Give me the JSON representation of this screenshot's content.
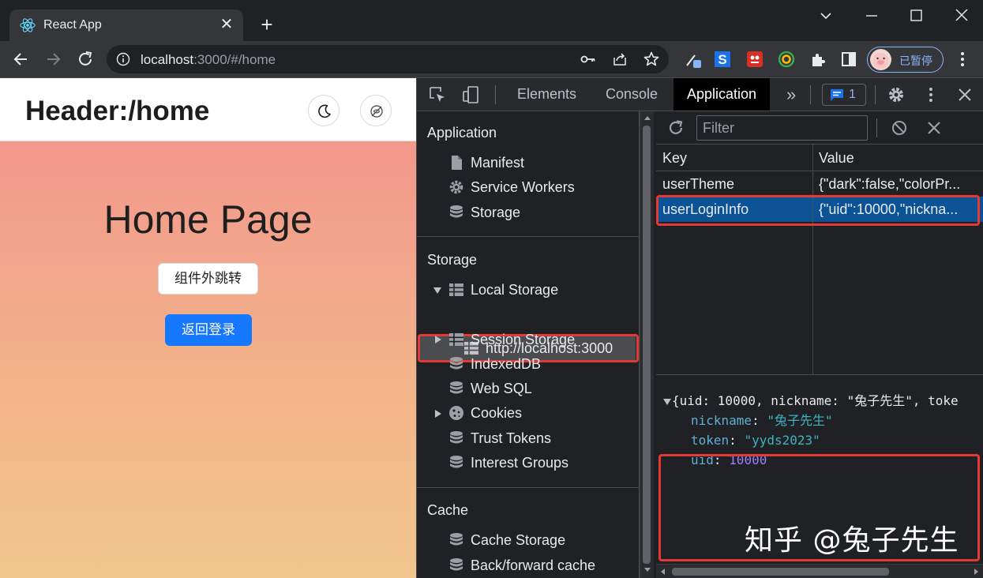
{
  "browser": {
    "tab_title": "React App",
    "tab_close": "✕",
    "new_tab": "+",
    "url_host": "localhost",
    "url_rest": ":3000/#/home",
    "profile_label": "已暂停"
  },
  "page": {
    "header_title": "Header:/home",
    "home_title": "Home Page",
    "button_outside_jump": "组件外跳转",
    "button_back_login": "返回登录"
  },
  "devtools": {
    "tabs": [
      "Elements",
      "Console",
      "Application"
    ],
    "active_tab": "Application",
    "more_tabs": "»",
    "issues_count": "1",
    "sidebar": {
      "application_section": "Application",
      "application_items": [
        "Manifest",
        "Service Workers",
        "Storage"
      ],
      "storage_section": "Storage",
      "local_storage": "Local Storage",
      "local_storage_origin": "http://localhost:3000",
      "storage_items": [
        "Session Storage",
        "IndexedDB",
        "Web SQL",
        "Cookies",
        "Trust Tokens",
        "Interest Groups"
      ],
      "cache_section": "Cache",
      "cache_items": [
        "Cache Storage",
        "Back/forward cache"
      ]
    },
    "filter_placeholder": "Filter",
    "table": {
      "columns": [
        "Key",
        "Value"
      ],
      "rows": [
        {
          "key": "userTheme",
          "value": "{\"dark\":false,\"colorPr..."
        },
        {
          "key": "userLoginInfo",
          "value": "{\"uid\":10000,\"nickna..."
        }
      ],
      "selected_row": 1
    },
    "preview": {
      "summary_open": "{uid: ",
      "summary_uid": "10000",
      "summary_mid": ", nickname: ",
      "summary_nick": "\"兔子先生\"",
      "summary_tail": ", toke",
      "fields": [
        {
          "key": "nickname",
          "value": "\"兔子先生\""
        },
        {
          "key": "token",
          "value": "\"yyds2023\""
        },
        {
          "key": "uid",
          "value": "10000"
        }
      ]
    }
  },
  "watermark": "知乎 @兔子先生",
  "colors": {
    "highlight_box": "#e53935",
    "selected_row": "#0c5396",
    "primary_button": "#1677ff"
  }
}
